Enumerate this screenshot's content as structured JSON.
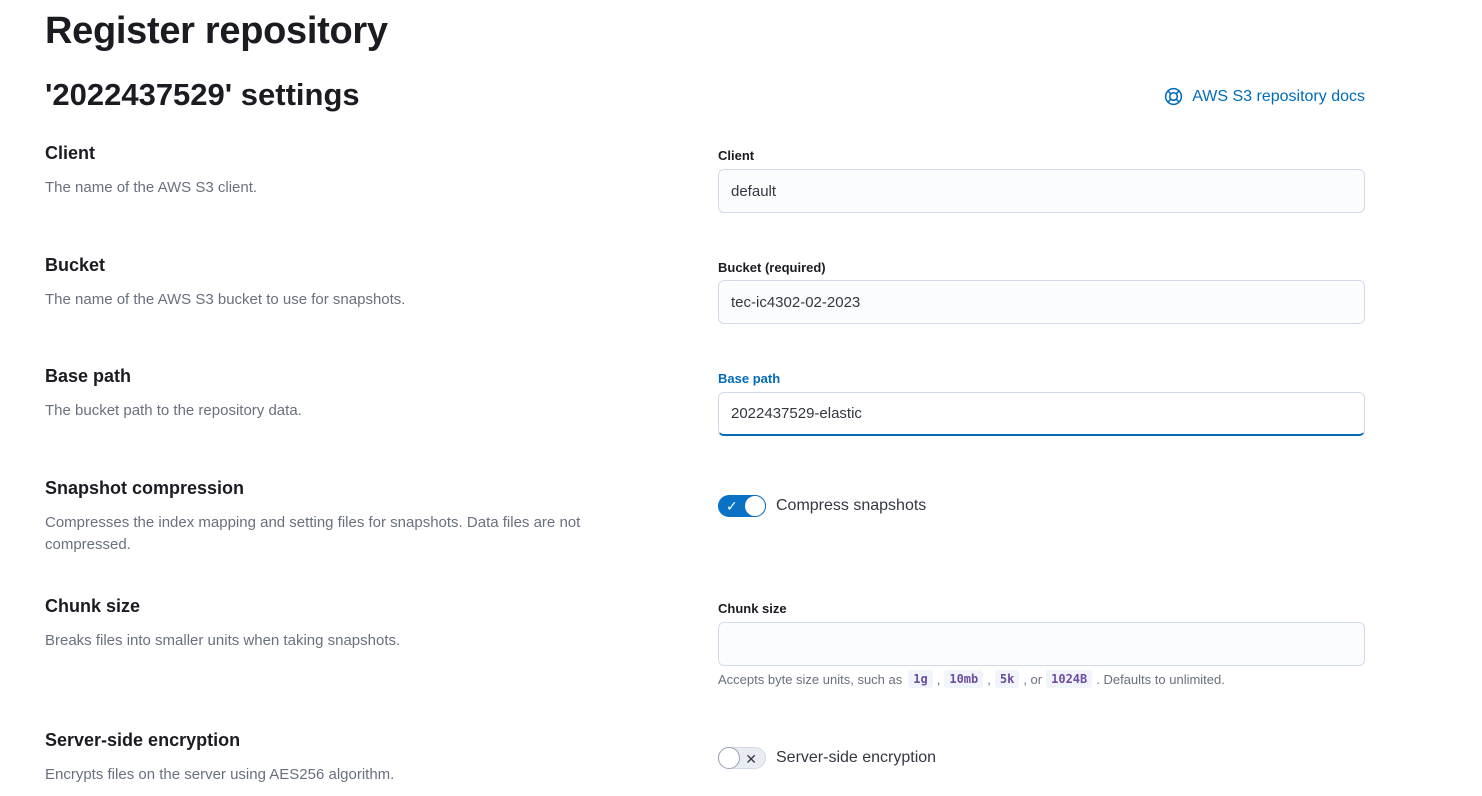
{
  "page": {
    "title": "Register repository",
    "section_title": "'2022437529' settings",
    "docs_link": "AWS S3 repository docs",
    "docs_icon": "help-icon"
  },
  "client": {
    "title": "Client",
    "description": "The name of the AWS S3 client.",
    "label": "Client",
    "value": "default"
  },
  "bucket": {
    "title": "Bucket",
    "description": "The name of the AWS S3 bucket to use for snapshots.",
    "label": "Bucket (required)",
    "value": "tec-ic4302-02-2023"
  },
  "base_path": {
    "title": "Base path",
    "description": "The bucket path to the repository data.",
    "label": "Base path",
    "value": "2022437529-elastic"
  },
  "compression": {
    "title": "Snapshot compression",
    "description": "Compresses the index mapping and setting files for snapshots. Data files are not compressed.",
    "switch_label": "Compress snapshots",
    "checked": true
  },
  "chunk_size": {
    "title": "Chunk size",
    "description": "Breaks files into smaller units when taking snapshots.",
    "label": "Chunk size",
    "value": "",
    "help_prefix": "Accepts byte size units, such as",
    "help_codes": [
      "1g",
      "10mb",
      "5k",
      "1024B"
    ],
    "help_sep1": ",",
    "help_sep2": ",",
    "help_sep3": ", or",
    "help_suffix": ". Defaults to unlimited."
  },
  "encryption": {
    "title": "Server-side encryption",
    "description": "Encrypts files on the server using AES256 algorithm.",
    "switch_label": "Server-side encryption",
    "checked": false
  },
  "colors": {
    "accent": "#006bb8",
    "switch_on": "#0a72c4",
    "title_text": "#1a1c21",
    "muted_text": "#69707d"
  }
}
